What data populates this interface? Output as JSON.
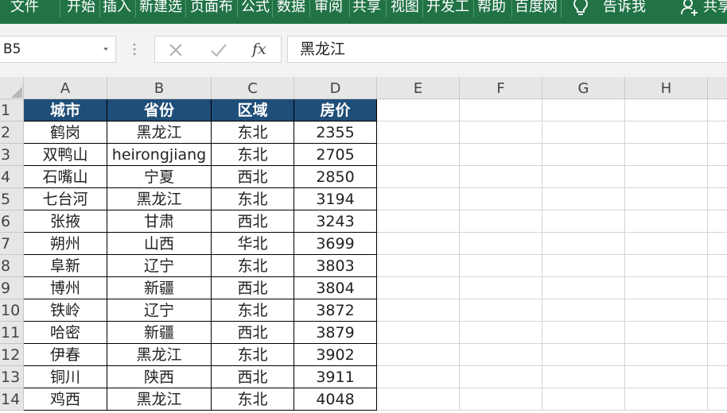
{
  "ribbon": {
    "tabs": [
      "文件",
      "开始",
      "插入",
      "新建选",
      "页面布",
      "公式",
      "数据",
      "审阅",
      "共享",
      "视图",
      "开发工",
      "帮助",
      "百度网"
    ],
    "tell_me": "告诉我",
    "share": "共享",
    "bg_color": "#217346"
  },
  "formula_bar": {
    "name_box": "B5",
    "formula": "黑龙江"
  },
  "sheet": {
    "columns": [
      "A",
      "B",
      "C",
      "D",
      "E",
      "F",
      "G",
      "H"
    ],
    "row_numbers": [
      "1",
      "2",
      "3",
      "4",
      "5",
      "6",
      "7",
      "8",
      "9",
      "10",
      "11",
      "12",
      "13",
      "14"
    ],
    "header_fill": "#1f4e78",
    "table_header": [
      "城市",
      "省份",
      "区域",
      "房价"
    ],
    "rows": [
      [
        "鹤岗",
        "黑龙江",
        "东北",
        "2355"
      ],
      [
        "双鸭山",
        "heirongjiang",
        "东北",
        "2705"
      ],
      [
        "石嘴山",
        "宁夏",
        "西北",
        "2850"
      ],
      [
        "七台河",
        "黑龙江",
        "东北",
        "3194"
      ],
      [
        "张掖",
        "甘肃",
        "西北",
        "3243"
      ],
      [
        "朔州",
        "山西",
        "华北",
        "3699"
      ],
      [
        "阜新",
        "辽宁",
        "东北",
        "3803"
      ],
      [
        "博州",
        "新疆",
        "西北",
        "3804"
      ],
      [
        "铁岭",
        "辽宁",
        "东北",
        "3872"
      ],
      [
        "哈密",
        "新疆",
        "西北",
        "3879"
      ],
      [
        "伊春",
        "黑龙江",
        "东北",
        "3902"
      ],
      [
        "铜川",
        "陕西",
        "西北",
        "3911"
      ],
      [
        "鸡西",
        "黑龙江",
        "东北",
        "4048"
      ]
    ]
  }
}
